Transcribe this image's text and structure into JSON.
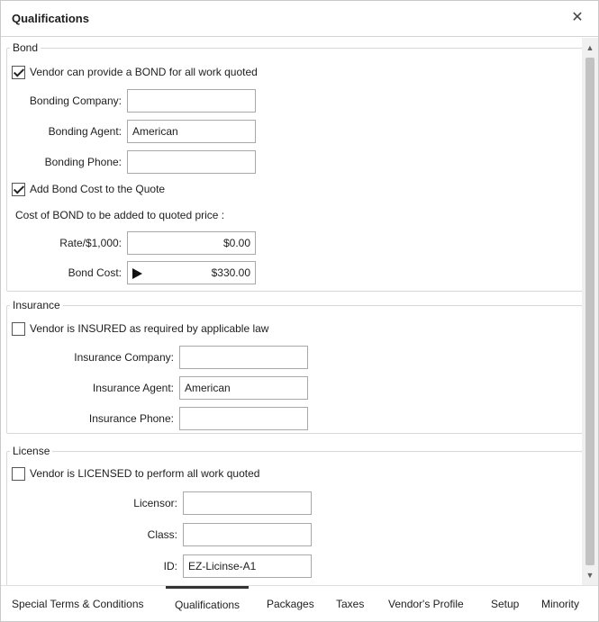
{
  "window": {
    "title": "Qualifications",
    "close_icon": "close-icon"
  },
  "bond": {
    "legend": "Bond",
    "provide_bond": {
      "label": "Vendor can provide a BOND for all work quoted",
      "checked": true
    },
    "bonding_company": {
      "label": "Bonding Company:",
      "value": ""
    },
    "bonding_agent": {
      "label": "Bonding Agent:",
      "value": "American"
    },
    "bonding_phone": {
      "label": "Bonding Phone:",
      "value": ""
    },
    "add_bond_cost": {
      "label": "Add Bond Cost to the Quote",
      "checked": true
    },
    "cost_note": "Cost of BOND to be added to quoted price :",
    "rate": {
      "label": "Rate/$1,000:",
      "value": "$0.00"
    },
    "bond_cost": {
      "label": "Bond Cost:",
      "value": "$330.00"
    }
  },
  "insurance": {
    "legend": "Insurance",
    "insured": {
      "label": "Vendor is INSURED as required by applicable law",
      "checked": false
    },
    "company": {
      "label": "Insurance Company:",
      "value": ""
    },
    "agent": {
      "label": "Insurance Agent:",
      "value": "American"
    },
    "phone": {
      "label": "Insurance Phone:",
      "value": ""
    }
  },
  "license": {
    "legend": "License",
    "licensed": {
      "label": "Vendor is LICENSED to perform all work quoted",
      "checked": false
    },
    "licensor": {
      "label": "Licensor:",
      "value": ""
    },
    "class": {
      "label": "Class:",
      "value": ""
    },
    "id": {
      "label": "ID:",
      "value": "EZ-Licinse-A1"
    }
  },
  "tabs": [
    {
      "label": "Special Terms & Conditions",
      "active": false
    },
    {
      "label": "Qualifications",
      "active": true
    },
    {
      "label": "Packages",
      "active": false
    },
    {
      "label": "Taxes",
      "active": false
    },
    {
      "label": "Vendor's Profile",
      "active": false
    },
    {
      "label": "Setup",
      "active": false
    },
    {
      "label": "Minority",
      "active": false
    }
  ]
}
